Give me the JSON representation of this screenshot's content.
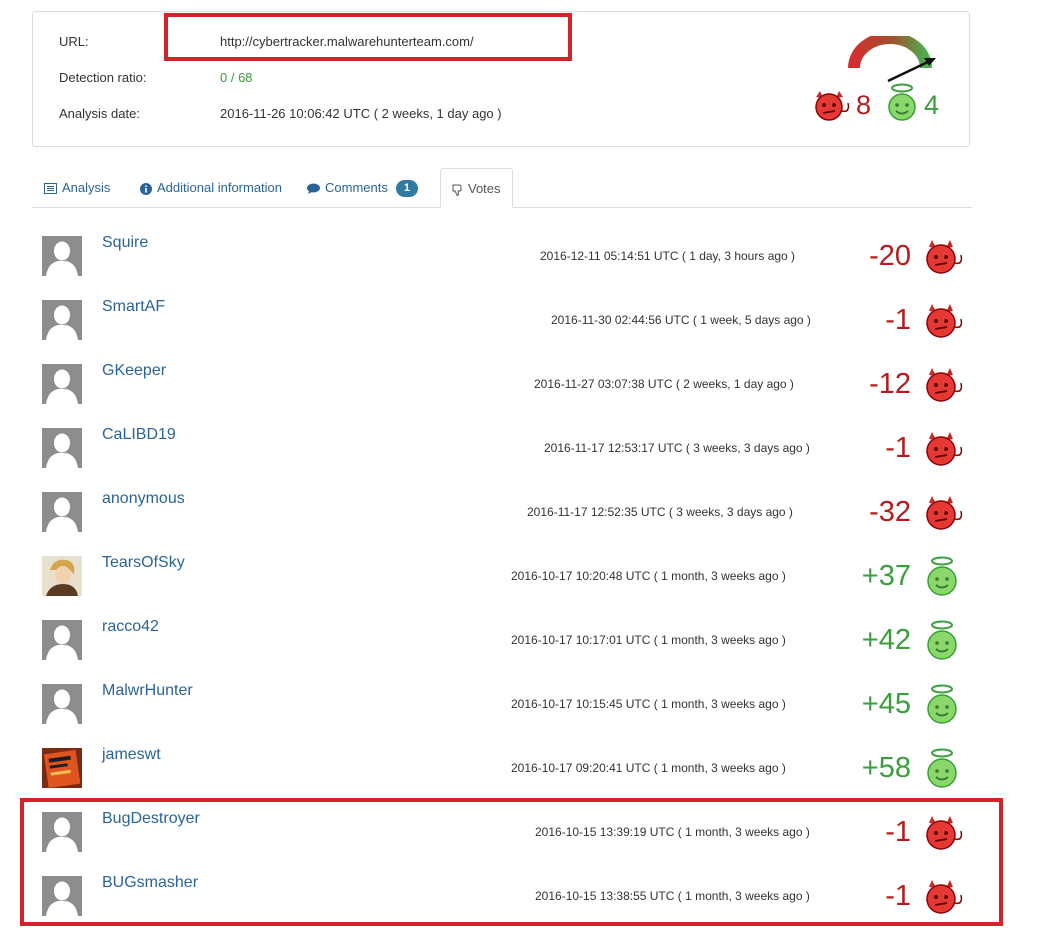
{
  "info": {
    "url_label": "URL:",
    "url_value": "http://cybertracker.malwarehunterteam.com/",
    "ratio_label": "Detection ratio:",
    "ratio_value": "0 / 68",
    "date_label": "Analysis date:",
    "date_value": "2016-11-26 10:06:42 UTC ( 2 weeks, 1 day ago )"
  },
  "gauge": {
    "bad_votes": "8",
    "good_votes": "4",
    "bad_color": "#b71c1c",
    "good_color": "#3a9e3a"
  },
  "tabs": [
    {
      "label": "Analysis",
      "icon": "list-icon"
    },
    {
      "label": "Additional information",
      "icon": "info-icon"
    },
    {
      "label": "Comments",
      "icon": "comment-icon",
      "badge": "1"
    },
    {
      "label": "Votes",
      "icon": "thumbs-down-icon",
      "active": true
    }
  ],
  "votes": [
    {
      "user": "Squire",
      "date": "2016-12-11 05:14:51 UTC ( 1 day, 3 hours ago )",
      "score": "-20",
      "verdict": "malicious",
      "avatar": "default"
    },
    {
      "user": "SmartAF",
      "date": "2016-11-30 02:44:56 UTC ( 1 week, 5 days ago )",
      "score": "-1",
      "verdict": "malicious",
      "avatar": "default"
    },
    {
      "user": "GKeeper",
      "date": "2016-11-27 03:07:38 UTC ( 2 weeks, 1 day ago )",
      "score": "-12",
      "verdict": "malicious",
      "avatar": "default"
    },
    {
      "user": "CaLIBD19",
      "date": "2016-11-17 12:53:17 UTC ( 3 weeks, 3 days ago )",
      "score": "-1",
      "verdict": "malicious",
      "avatar": "default"
    },
    {
      "user": "anonymous",
      "date": "2016-11-17 12:52:35 UTC ( 3 weeks, 3 days ago )",
      "score": "-32",
      "verdict": "malicious",
      "avatar": "default"
    },
    {
      "user": "TearsOfSky",
      "date": "2016-10-17 10:20:48 UTC ( 1 month, 3 weeks ago )",
      "score": "+37",
      "verdict": "harmless",
      "avatar": "photo-portrait"
    },
    {
      "user": "racco42",
      "date": "2016-10-17 10:17:01 UTC ( 1 month, 3 weeks ago )",
      "score": "+42",
      "verdict": "harmless",
      "avatar": "default"
    },
    {
      "user": "MalwrHunter",
      "date": "2016-10-17 10:15:45 UTC ( 1 month, 3 weeks ago )",
      "score": "+45",
      "verdict": "harmless",
      "avatar": "default"
    },
    {
      "user": "jameswt",
      "date": "2016-10-17 09:20:41 UTC ( 1 month, 3 weeks ago )",
      "score": "+58",
      "verdict": "harmless",
      "avatar": "photo-book"
    },
    {
      "user": "BugDestroyer",
      "date": "2016-10-15 13:39:19 UTC ( 1 month, 3 weeks ago )",
      "score": "-1",
      "verdict": "malicious",
      "avatar": "default"
    },
    {
      "user": "BUGsmasher",
      "date": "2016-10-15 13:38:55 UTC ( 1 month, 3 weeks ago )",
      "score": "-1",
      "verdict": "malicious",
      "avatar": "default"
    }
  ]
}
